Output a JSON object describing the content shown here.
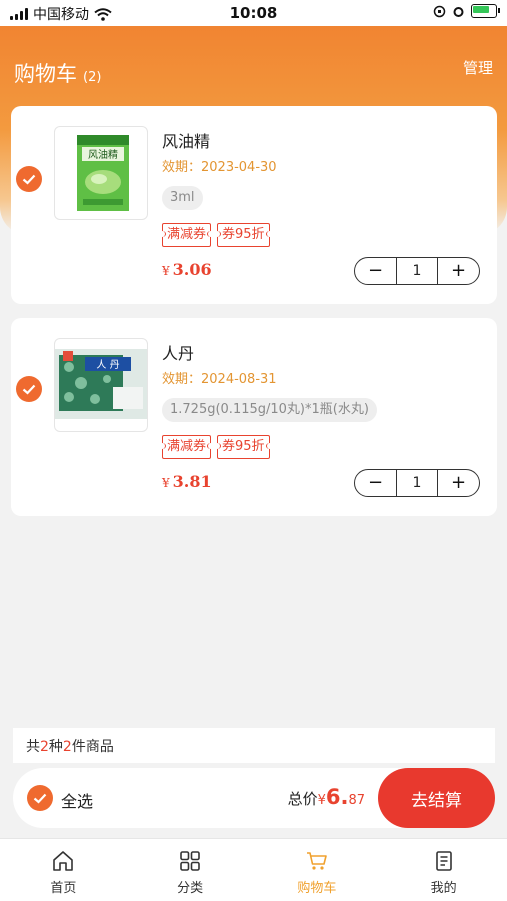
{
  "status_bar": {
    "carrier": "中国移动",
    "time": "10:08"
  },
  "header": {
    "title": "购物车",
    "count": "(2)",
    "manage_label": "管理"
  },
  "cart": {
    "items": [
      {
        "name": "风油精",
        "expiry": "效期：2023-04-30",
        "spec": "3ml",
        "coupons": [
          "满减券",
          "券95折"
        ],
        "currency": "¥",
        "price": "3.06",
        "quantity": "1",
        "checked": true
      },
      {
        "name": "人丹",
        "expiry": "效期：2024-08-31",
        "spec": "1.725g(0.115g/10丸)*1瓶(水丸)",
        "coupons": [
          "满减券",
          "券95折"
        ],
        "currency": "¥",
        "price": "3.81",
        "quantity": "1",
        "checked": true
      }
    ]
  },
  "summary": {
    "prefix": "共",
    "kinds": "2",
    "mid": "种",
    "pieces": "2",
    "suffix": "件商品",
    "select_all_label": "全选",
    "total_label": "总价",
    "currency": "¥",
    "total_int": "6.",
    "total_dec": "87",
    "checkout_label": "去结算"
  },
  "tabbar": {
    "items": [
      {
        "label": "首页",
        "icon": "home-icon"
      },
      {
        "label": "分类",
        "icon": "category-icon"
      },
      {
        "label": "购物车",
        "icon": "cart-icon"
      },
      {
        "label": "我的",
        "icon": "profile-icon"
      }
    ],
    "active_index": 2
  },
  "colors": {
    "accent": "#ef6a2f",
    "price": "#e8432f",
    "checkout": "#e8392e",
    "tab_active": "#f0a12e"
  }
}
